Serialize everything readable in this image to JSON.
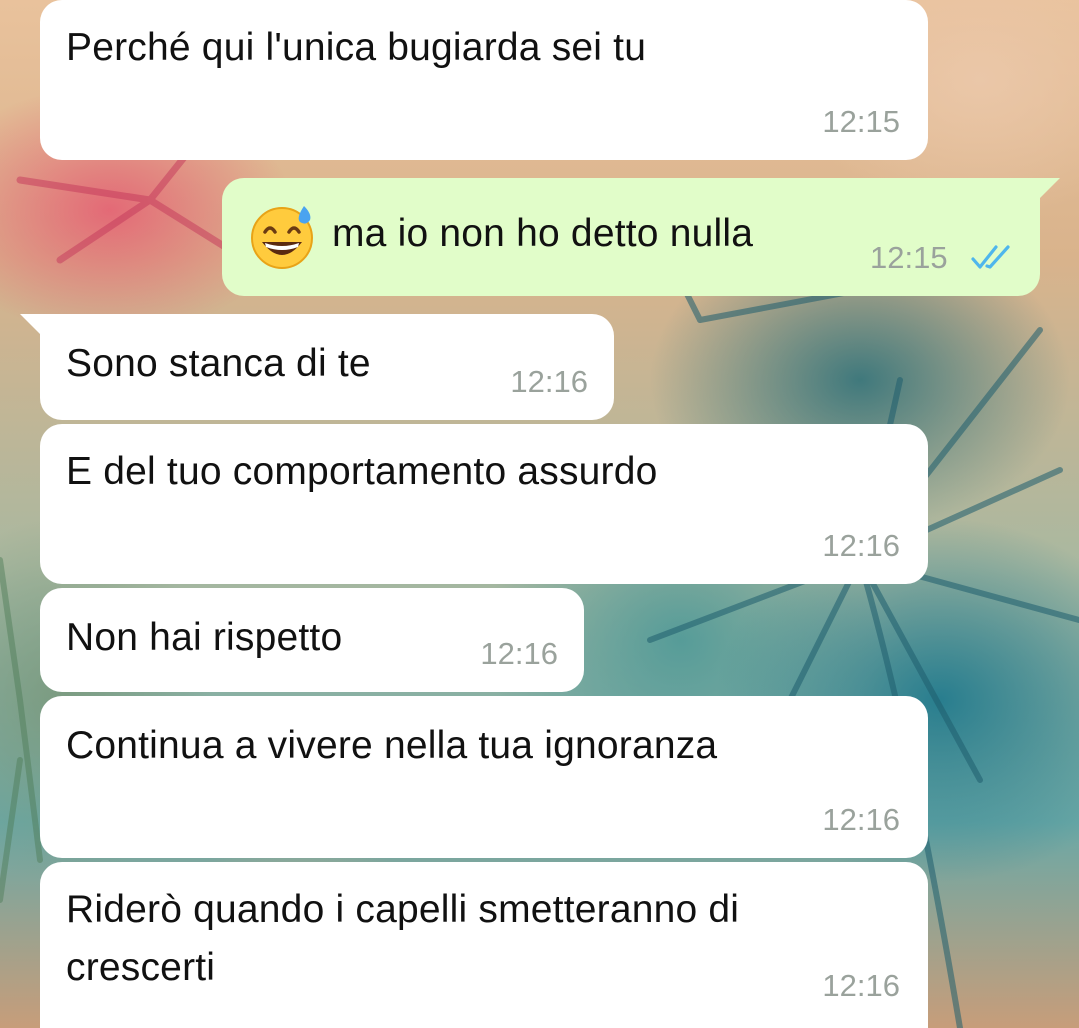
{
  "messages": [
    {
      "text": "Perché qui l'unica bugiarda sei tu",
      "time": "12:15",
      "direction": "incoming"
    },
    {
      "text": "ma io non ho detto nulla",
      "time": "12:15",
      "direction": "outgoing",
      "emoji": "grinning-face-with-sweat",
      "status": "read"
    },
    {
      "text": "Sono stanca di te",
      "time": "12:16",
      "direction": "incoming"
    },
    {
      "text": "E del tuo comportamento assurdo",
      "time": "12:16",
      "direction": "incoming"
    },
    {
      "text": "Non hai rispetto",
      "time": "12:16",
      "direction": "incoming"
    },
    {
      "text": "Continua a vivere nella tua ignoranza",
      "time": "12:16",
      "direction": "incoming"
    },
    {
      "text_line1": "Riderò quando i capelli smetteranno di",
      "text_line2": "crescerti",
      "time": "12:16",
      "direction": "incoming"
    }
  ],
  "colors": {
    "incoming_bubble": "#ffffff",
    "outgoing_bubble": "#e1fdc9",
    "timestamp": "#9aa29c",
    "read_ticks": "#4fb6ec"
  }
}
